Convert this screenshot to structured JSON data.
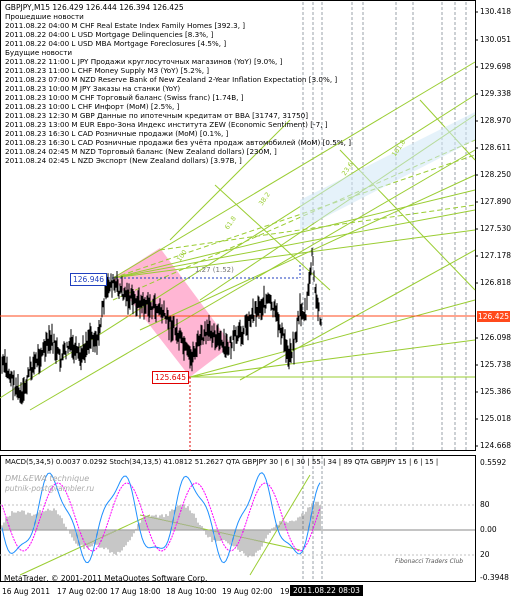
{
  "header": "GBPJPY,M15  126.429 126.444 126.394 126.425",
  "news_lines": [
    "        Прошедшие новости",
    "2011.08.22 04:00 M CHF Real Estate Index Family Homes [392.3, ]",
    "2011.08.22 04:00 L USD Mortgage Delinquencies [8.3%, ]",
    "2011.08.22 04:00 L USD MBA Mortgage Foreclosures [4.5%, ]",
    "        Будущие новости",
    "2011.08.22 11:00 L JPY Продажи круглосуточных магазинов (YoY) [9.0%, ]",
    "2011.08.23 11:00 L CHF Money Supply M3 (YoY) [5.2%, ]",
    "2011.08.23 07:00 M NZD Reserve Bank of New Zealand 2-Year Inflation Expectation [3.0%, ]",
    "2011.08.23 10:00 M JPY Заказы на станки (YoY)",
    "2011.08.23 10:00 M CHF Торговый баланс (Swiss franc) [1.74B, ]",
    "2011.08.23 10:00 L CHF Инфорт (MoM) [2.5%, ]",
    "2011.08.23 12:30 M GBP Данные по ипотечным кредитам от BBA [31747, 31750]",
    "2011.08.23 13:00 M EUR Евро-Зона Индекс института ZEW (Economic Sentiment) [-7, ]",
    "2011.08.23 16:30 L CAD Розничные продажи (MoM) [0.1%, ]",
    "2011.08.23 16:30 L CAD Розничные продажи без учёта продаж автомобилей (MoM) [0.5%, ]",
    "2011.08.24 02:45 M NZD Торговый баланс (New Zealand dollars) [230M, ]",
    "2011.08.24 02:45 L NZD Экспорт (New Zealand dollars) [3.97B, ]"
  ],
  "price_scale": [
    "130.418",
    "130.051",
    "129.698",
    "129.338",
    "128.970",
    "128.611",
    "128.250",
    "127.890",
    "127.530",
    "127.178",
    "126.818",
    "126.425",
    "126.098",
    "125.738",
    "125.386",
    "125.018",
    "124.668"
  ],
  "price_tags": {
    "high": "126.946",
    "low": "125.645",
    "current": "126.425",
    "fib_note": "1.27 (1.52)"
  },
  "fib_labels": [
    "61.8",
    "38.2",
    "23.6",
    "100",
    "161.8"
  ],
  "indicator": {
    "title": "MACD(5,34,5)  0.0037 0.0292  Stoch(34,13,5) 41.0812 51.2627  QTA  GBPJPY 30 | 6 | 30 | 55 | 34 | 89  QTA  GBPJPY 15 | 6 | 15 |",
    "top_value": "0.5592",
    "scale": [
      "80",
      "0.00",
      "20",
      "-0.3948"
    ],
    "watermark_lines": [
      "DML&EWA technique",
      "putnik-post@rambler.ru"
    ],
    "club": "Fibonacci Traders Club"
  },
  "footer": "MetaTrader, © 2001-2011 MetaQuotes Software Corp.",
  "time_axis": [
    "16 Aug 2011",
    "17 Aug 02:00",
    "17 Aug 18:00",
    "18 Aug 10:00",
    "19 Aug 02:00",
    "19 Aug 18:00",
    "19 A"
  ],
  "time_cursor": "2011.08.22 08:03",
  "colors": {
    "bars": "#000000",
    "bid_line": "#ff4a1c",
    "channel": "#9acd32",
    "pink_zone": "#ff9ec6",
    "tag_blue": "#1f3fbf",
    "tag_red": "#e00000",
    "macd_hist": "#a9a9a9",
    "stoch_main": "#1e90ff",
    "stoch_signal": "#ff00ff"
  }
}
